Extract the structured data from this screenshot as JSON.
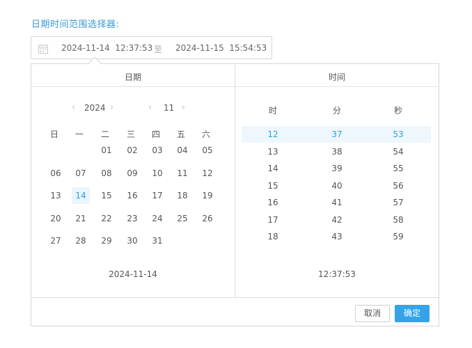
{
  "title": "日期时间范围选择器:",
  "range_input": {
    "start": "2024-11-14  12:37:53",
    "separator": "至",
    "end": "2024-11-15  15:54:53",
    "icon": "calendar-icon"
  },
  "panel": {
    "date_header": "日期",
    "time_header": "时间",
    "year": "2024",
    "month": "11",
    "weekdays": [
      "日",
      "一",
      "二",
      "三",
      "四",
      "五",
      "六"
    ],
    "weeks": [
      [
        "",
        "",
        "01",
        "02",
        "03",
        "04",
        "05"
      ],
      [
        "06",
        "07",
        "08",
        "09",
        "10",
        "11",
        "12"
      ],
      [
        "13",
        "14",
        "15",
        "16",
        "17",
        "18",
        "19"
      ],
      [
        "20",
        "21",
        "22",
        "23",
        "24",
        "25",
        "26"
      ],
      [
        "27",
        "28",
        "29",
        "30",
        "31",
        "",
        ""
      ]
    ],
    "selected_day": "14",
    "date_footer": "2024-11-14",
    "time_columns": [
      "时",
      "分",
      "秒"
    ],
    "hours": [
      "12",
      "13",
      "14",
      "15",
      "16",
      "17",
      "18"
    ],
    "minutes": [
      "37",
      "38",
      "39",
      "40",
      "41",
      "42",
      "43"
    ],
    "seconds": [
      "53",
      "54",
      "55",
      "56",
      "57",
      "58",
      "59"
    ],
    "time_footer": "12:37:53",
    "cancel_label": "取消",
    "confirm_label": "确定",
    "colors": {
      "accent": "#36a3e8",
      "selected_text": "#2f9fd8",
      "selected_bg": "#eaf5fc",
      "title": "#3a9ad9"
    }
  }
}
